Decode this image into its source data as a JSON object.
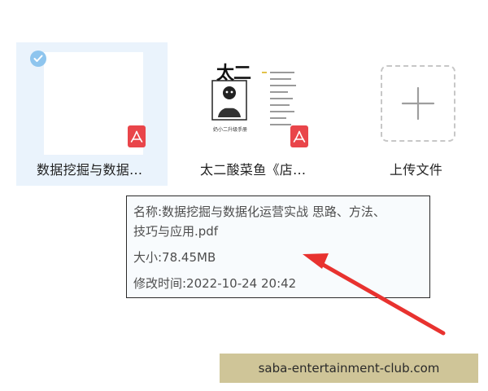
{
  "files": [
    {
      "name": "数据挖掘与数据...",
      "icon": "pdf-icon",
      "selected": true
    },
    {
      "name": "太二酸菜鱼《店...",
      "icon": "pdf-icon",
      "selected": false,
      "cover_title": "太二",
      "cover_caption": "奶小二升级手册"
    }
  ],
  "upload": {
    "label": "上传文件",
    "icon": "plus-icon"
  },
  "tooltip": {
    "name_line1": "名称:数据挖掘与数据化运营实战 思路、方法、",
    "name_line2": "技巧与应用.pdf",
    "size": "大小:78.45MB",
    "modified": "修改时间:2022-10-24 20:42"
  },
  "watermark": {
    "text": "saba-entertainment-club.com"
  },
  "colors": {
    "selection_bg": "#eaf3fc",
    "check_blue": "#8ec5ee",
    "pdf_red": "#e9454a",
    "arrow_red": "#e8322f",
    "tooltip_bg": "#f8fbfd",
    "watermark_bg": "#cfc598"
  }
}
